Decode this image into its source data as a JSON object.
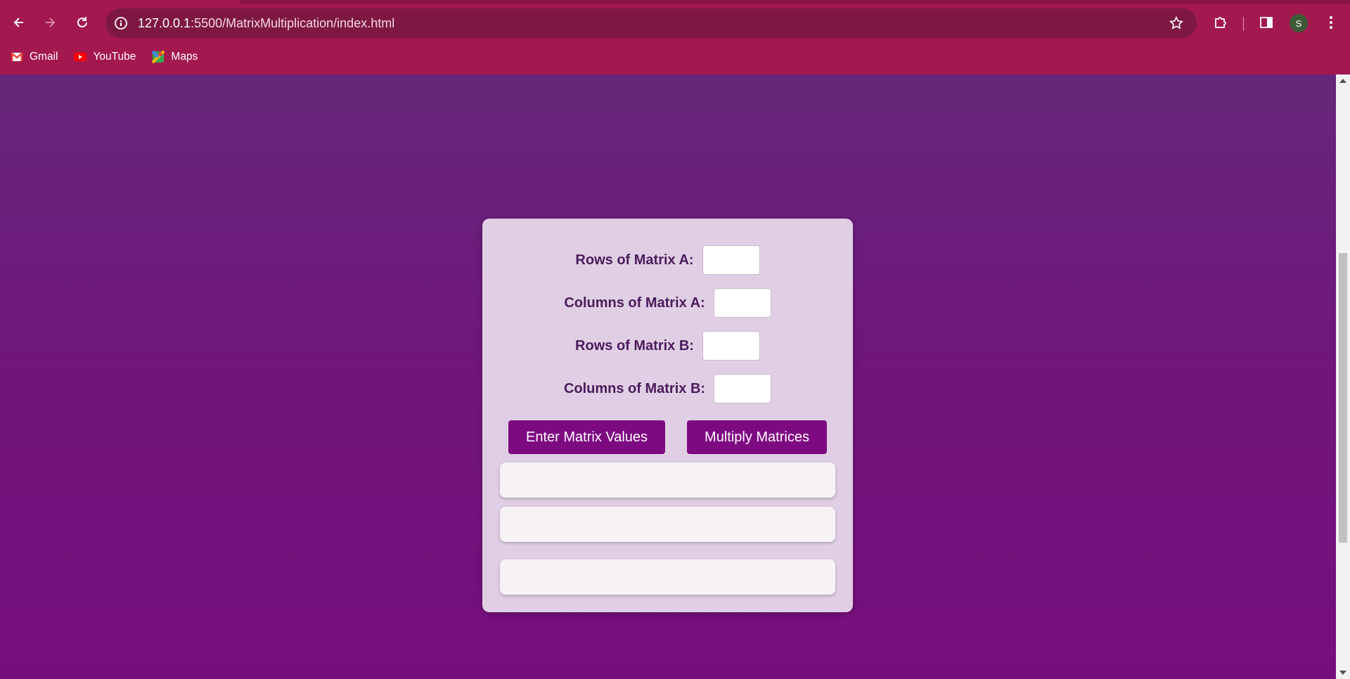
{
  "browser": {
    "url_host": "127.0.0.1",
    "url_rest": ":5500/MatrixMultiplication/index.html",
    "avatar_letter": "S",
    "bookmarks": [
      {
        "label": "Gmail",
        "icon": "gmail-icon"
      },
      {
        "label": "YouTube",
        "icon": "youtube-icon"
      },
      {
        "label": "Maps",
        "icon": "maps-icon"
      }
    ]
  },
  "form": {
    "rows_a_label": "Rows of Matrix A:",
    "cols_a_label": "Columns of Matrix A:",
    "rows_b_label": "Rows of Matrix B:",
    "cols_b_label": "Columns of Matrix B:",
    "rows_a_value": "",
    "cols_a_value": "",
    "rows_b_value": "",
    "cols_b_value": ""
  },
  "buttons": {
    "enter_label": "Enter Matrix Values",
    "multiply_label": "Multiply Matrices"
  },
  "colors": {
    "accent": "#7e0a82",
    "chrome": "#a3184f",
    "card": "#e0cfe4"
  }
}
